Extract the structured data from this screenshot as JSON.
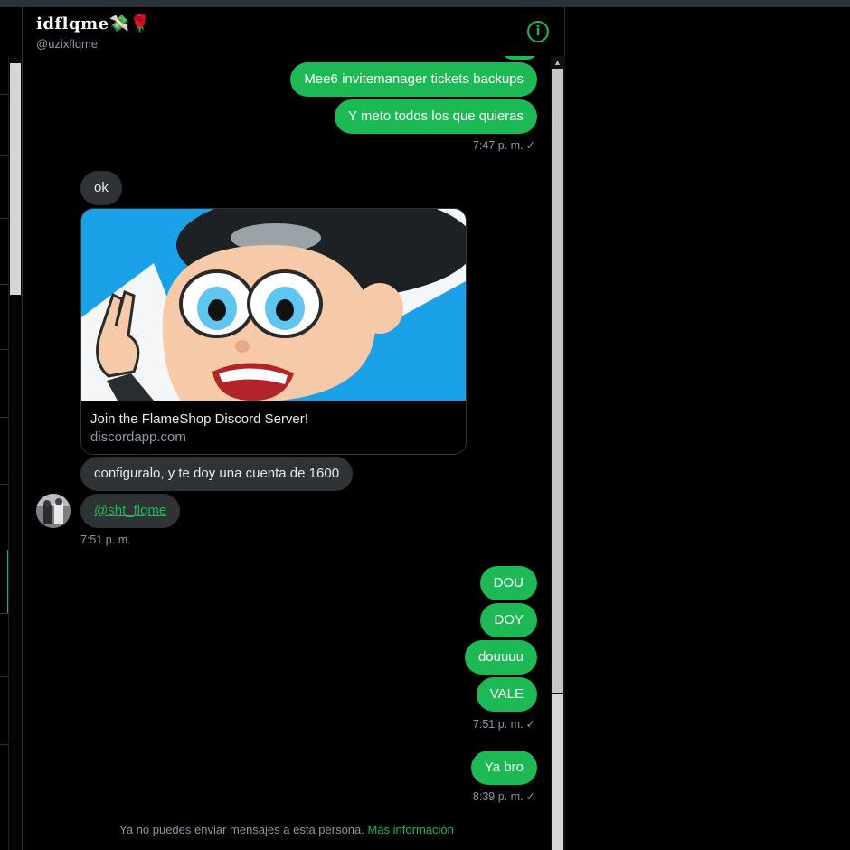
{
  "header": {
    "display_name": "𝐢𝐝𝐟𝐥𝐪𝐦𝐞💸🌹",
    "handle": "@uzixflqme",
    "info_glyph": "i"
  },
  "messages": [
    {
      "id": "m1",
      "dir": "out",
      "text": "Mee6 invitemanager tickets backups"
    },
    {
      "id": "m2",
      "dir": "out",
      "text": "Y meto todos los que quieras"
    },
    {
      "id": "m3",
      "dir": "in",
      "text": "ok"
    },
    {
      "id": "m4",
      "dir": "in",
      "text": "configuralo, y te doy una cuenta de 1600"
    },
    {
      "id": "m5",
      "dir": "in",
      "text": "@sht_flqme"
    },
    {
      "id": "m6",
      "dir": "out",
      "text": "DOU"
    },
    {
      "id": "m7",
      "dir": "out",
      "text": "DOY"
    },
    {
      "id": "m8",
      "dir": "out",
      "text": "douuuu"
    },
    {
      "id": "m9",
      "dir": "out",
      "text": "VALE"
    },
    {
      "id": "m10",
      "dir": "out",
      "text": "Ya bro"
    }
  ],
  "timestamps": {
    "t1": "7:47 p. m.",
    "t2": "7:51 p. m.",
    "t3": "7:51 p. m.",
    "t4": "8:39 p. m."
  },
  "check_glyph": "✓",
  "link_card": {
    "title": "Join the FlameShop Discord Server!",
    "domain": "discordapp.com"
  },
  "footer": {
    "text": "Ya no puedes enviar mensajes a esta persona.",
    "link": "Más información"
  },
  "colors": {
    "accent": "#1db954",
    "outgoing_bubble": "#1db954",
    "incoming_bubble": "#2f3336",
    "background": "#000000"
  },
  "icons": {
    "info": "info-circle-icon",
    "scroll_up": "chevron-up-icon"
  }
}
